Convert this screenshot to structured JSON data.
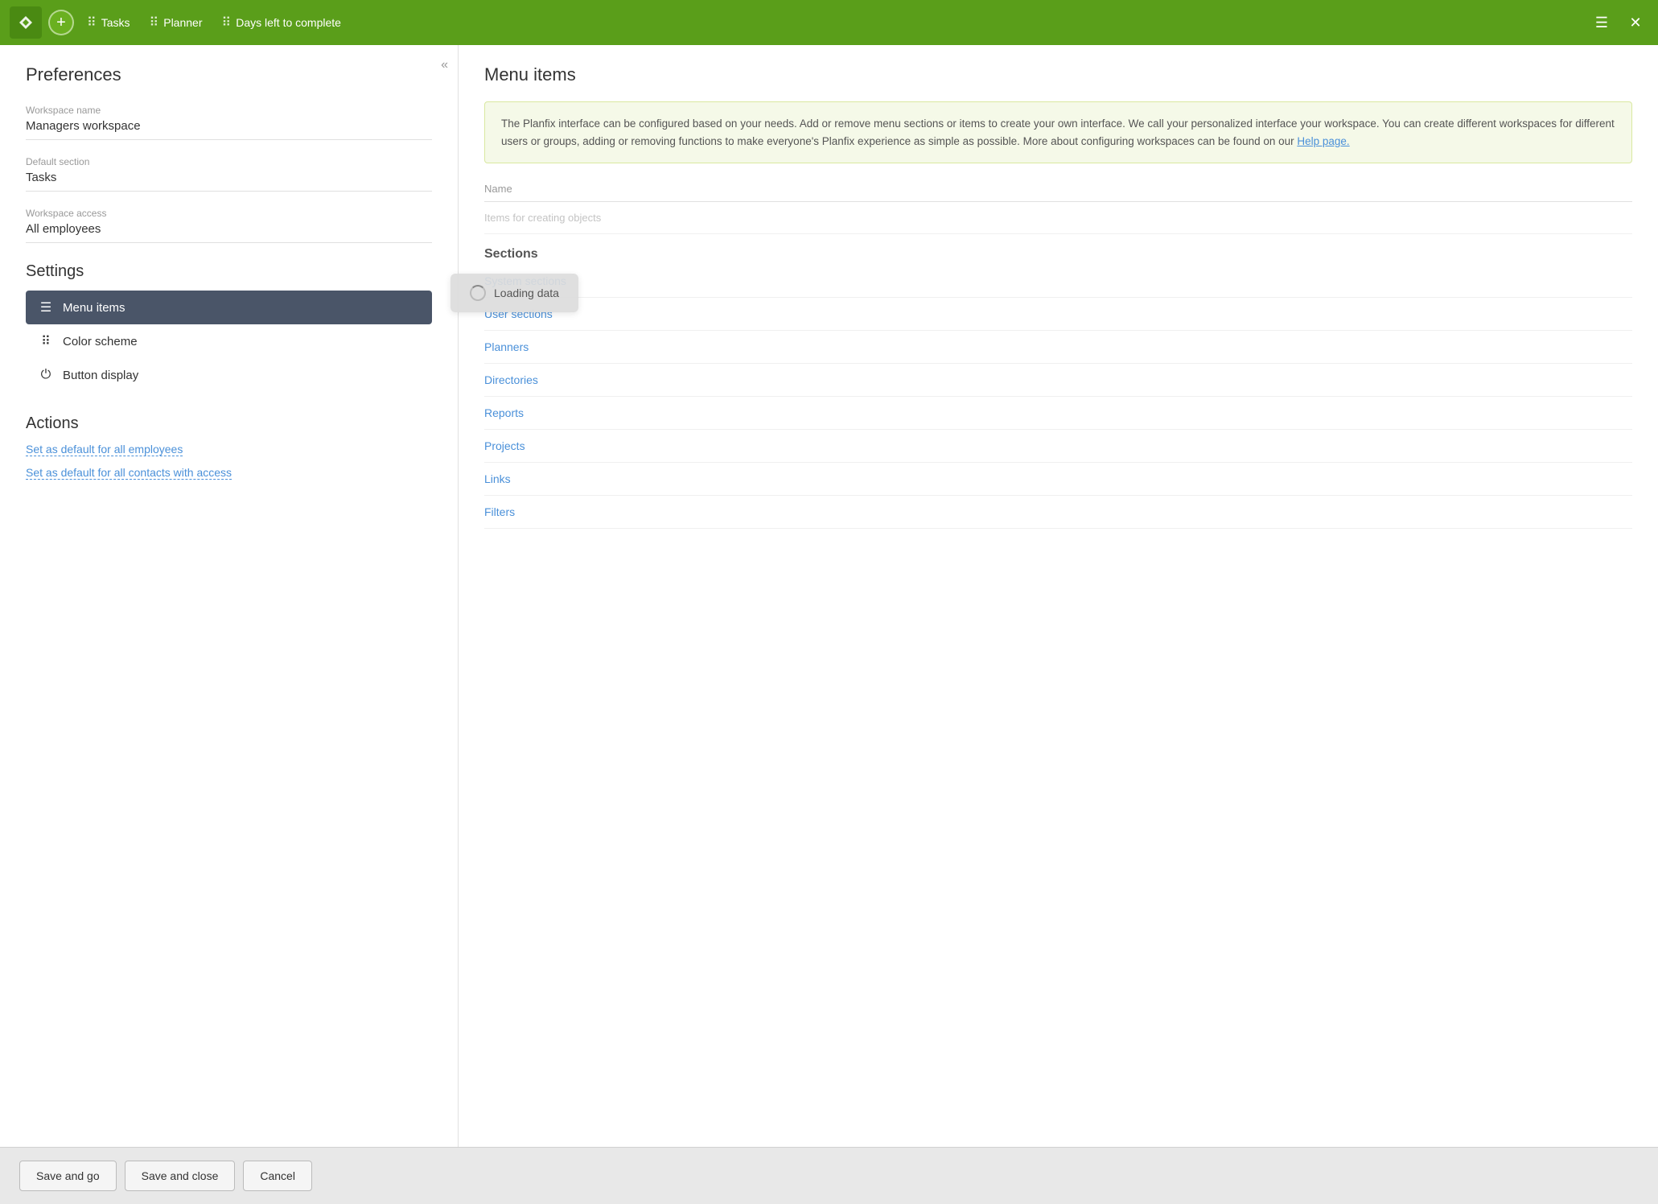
{
  "topbar": {
    "logo_text": "P",
    "add_label": "+",
    "items": [
      {
        "label": "Tasks",
        "icon": "⠿"
      },
      {
        "label": "Planner",
        "icon": "⠿"
      },
      {
        "label": "Days left to complete",
        "icon": "⠿"
      }
    ],
    "menu_icon": "☰",
    "close_icon": "✕"
  },
  "left": {
    "collapse_icon": "«",
    "preferences_title": "Preferences",
    "workspace_name_label": "Workspace name",
    "workspace_name_value": "Managers workspace",
    "default_section_label": "Default section",
    "default_section_value": "Tasks",
    "workspace_access_label": "Workspace access",
    "workspace_access_value": "All employees",
    "settings_title": "Settings",
    "settings_items": [
      {
        "id": "menu-items",
        "label": "Menu items",
        "icon": "☰",
        "active": true
      },
      {
        "id": "color-scheme",
        "label": "Color scheme",
        "icon": "⠿",
        "active": false
      },
      {
        "id": "button-display",
        "label": "Button display",
        "icon": "⏻",
        "active": false
      }
    ],
    "actions_title": "Actions",
    "action_links": [
      {
        "id": "set-default-employees",
        "label": "Set as default for all employees"
      },
      {
        "id": "set-default-contacts",
        "label": "Set as default for all contacts with access"
      }
    ]
  },
  "right": {
    "title": "Menu items",
    "info_text": "The Planfix interface can be configured based on your needs. Add or remove menu sections or items to create your own interface. We call your personalized interface your workspace. You can create different workspaces for different users or groups, adding or removing functions to make everyone's Planfix experience as simple as possible. More about configuring workspaces can be found on our ",
    "info_link_text": "Help page.",
    "info_link_url": "#",
    "name_column": "Name",
    "items_placeholder": "Items for creating objects",
    "sections_title": "Sections",
    "sections": [
      {
        "label": "System sections"
      },
      {
        "label": "User sections"
      },
      {
        "label": "Planners"
      },
      {
        "label": "Directories"
      },
      {
        "label": "Reports"
      },
      {
        "label": "Projects"
      },
      {
        "label": "Links"
      },
      {
        "label": "Filters"
      }
    ]
  },
  "loading": {
    "text": "Loading data"
  },
  "footer": {
    "save_go_label": "Save and go",
    "save_close_label": "Save and close",
    "cancel_label": "Cancel"
  }
}
